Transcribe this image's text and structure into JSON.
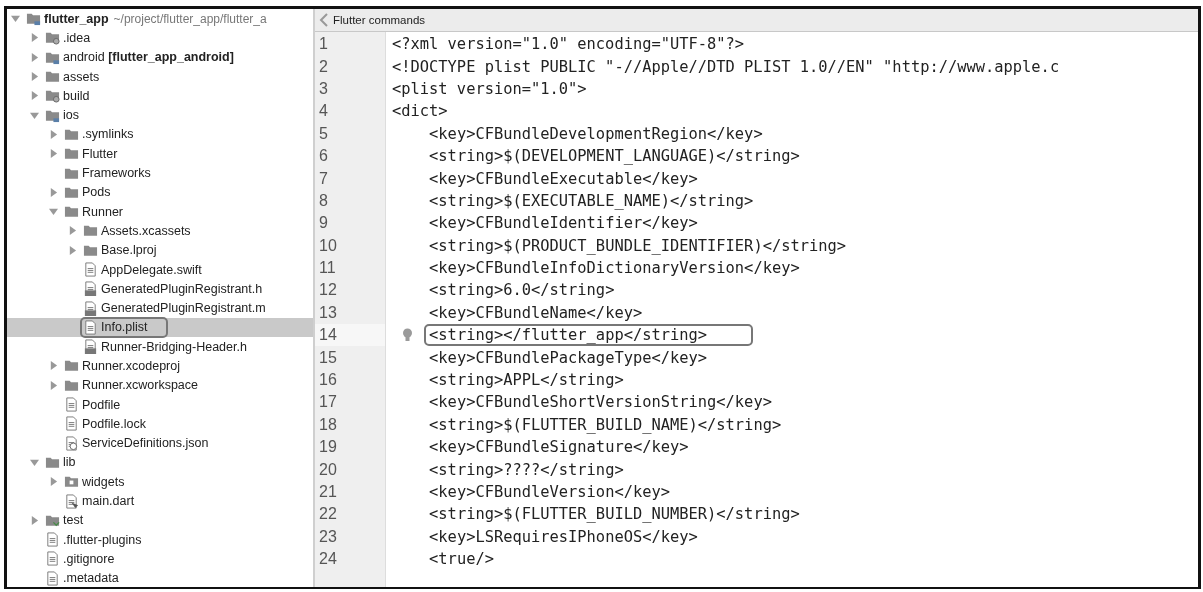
{
  "project_tree": {
    "root": {
      "label": "flutter_app",
      "path": "~/project/flutter_app/flutter_a",
      "kind": "module",
      "expanded": true,
      "children": [
        {
          "label": ".idea",
          "kind": "special-folder",
          "expanded": false
        },
        {
          "label": "android **[flutter_app_android]**",
          "kind": "module",
          "expanded": false
        },
        {
          "label": "assets",
          "kind": "folder",
          "expanded": false
        },
        {
          "label": "build",
          "kind": "special-folder",
          "expanded": false
        },
        {
          "label": "ios",
          "kind": "module",
          "expanded": true,
          "children": [
            {
              "label": ".symlinks",
              "kind": "folder",
              "expanded": false
            },
            {
              "label": "Flutter",
              "kind": "folder",
              "expanded": false
            },
            {
              "label": "Frameworks",
              "kind": "folder"
            },
            {
              "label": "Pods",
              "kind": "folder",
              "expanded": false
            },
            {
              "label": "Runner",
              "kind": "folder",
              "expanded": true,
              "children": [
                {
                  "label": "Assets.xcassets",
                  "kind": "folder",
                  "expanded": false
                },
                {
                  "label": "Base.lproj",
                  "kind": "folder",
                  "expanded": false
                },
                {
                  "label": "AppDelegate.swift",
                  "kind": "file"
                },
                {
                  "label": "GeneratedPluginRegistrant.h",
                  "kind": "cpp-file"
                },
                {
                  "label": "GeneratedPluginRegistrant.m",
                  "kind": "cpp-file"
                },
                {
                  "label": "Info.plist",
                  "kind": "file",
                  "selected": true,
                  "boxed": true
                },
                {
                  "label": "Runner-Bridging-Header.h",
                  "kind": "cpp-file"
                }
              ]
            },
            {
              "label": "Runner.xcodeproj",
              "kind": "folder",
              "expanded": false
            },
            {
              "label": "Runner.xcworkspace",
              "kind": "folder",
              "expanded": false
            },
            {
              "label": "Podfile",
              "kind": "file"
            },
            {
              "label": "Podfile.lock",
              "kind": "file"
            },
            {
              "label": "ServiceDefinitions.json",
              "kind": "json-file"
            }
          ]
        },
        {
          "label": "lib",
          "kind": "folder",
          "expanded": true,
          "children": [
            {
              "label": "widgets",
              "kind": "package-folder",
              "expanded": false
            },
            {
              "label": "main.dart",
              "kind": "dart-file"
            }
          ]
        },
        {
          "label": "test",
          "kind": "test-folder",
          "expanded": false
        },
        {
          "label": ".flutter-plugins",
          "kind": "file"
        },
        {
          "label": ".gitignore",
          "kind": "file"
        },
        {
          "label": ".metadata",
          "kind": "file"
        }
      ]
    }
  },
  "editor": {
    "header": "Flutter commands",
    "lines": [
      {
        "number": "1",
        "text": "<?xml version=\"1.0\" encoding=\"UTF-8\"?>"
      },
      {
        "number": "2",
        "text": "<!DOCTYPE plist PUBLIC \"-//Apple//DTD PLIST 1.0//EN\" \"http://www.apple.c"
      },
      {
        "number": "3",
        "text": "<plist version=\"1.0\">"
      },
      {
        "number": "4",
        "text": "<dict>"
      },
      {
        "number": "5",
        "text": "    <key>CFBundleDevelopmentRegion</key>"
      },
      {
        "number": "6",
        "text": "    <string>$(DEVELOPMENT_LANGUAGE)</string>"
      },
      {
        "number": "7",
        "text": "    <key>CFBundleExecutable</key>"
      },
      {
        "number": "8",
        "text": "    <string>$(EXECUTABLE_NAME)</string>"
      },
      {
        "number": "9",
        "text": "    <key>CFBundleIdentifier</key>"
      },
      {
        "number": "10",
        "text": "    <string>$(PRODUCT_BUNDLE_IDENTIFIER)</string>"
      },
      {
        "number": "11",
        "text": "    <key>CFBundleInfoDictionaryVersion</key>"
      },
      {
        "number": "12",
        "text": "    <string>6.0</string>"
      },
      {
        "number": "13",
        "text": "    <key>CFBundleName</key>"
      },
      {
        "number": "14",
        "text": "    <string></flutter_app</string>",
        "current": true,
        "boxed": true,
        "bulb": true
      },
      {
        "number": "15",
        "text": "    <key>CFBundlePackageType</key>"
      },
      {
        "number": "16",
        "text": "    <string>APPL</string>"
      },
      {
        "number": "17",
        "text": "    <key>CFBundleShortVersionString</key>"
      },
      {
        "number": "18",
        "text": "    <string>$(FLUTTER_BUILD_NAME)</string>"
      },
      {
        "number": "19",
        "text": "    <key>CFBundleSignature</key>"
      },
      {
        "number": "20",
        "text": "    <string>????</string>"
      },
      {
        "number": "21",
        "text": "    <key>CFBundleVersion</key>"
      },
      {
        "number": "22",
        "text": "    <string>$(FLUTTER_BUILD_NUMBER)</string>"
      },
      {
        "number": "23",
        "text": "    <key>LSRequiresIPhoneOS</key>"
      },
      {
        "number": "24",
        "text": "    <true/>"
      }
    ]
  }
}
